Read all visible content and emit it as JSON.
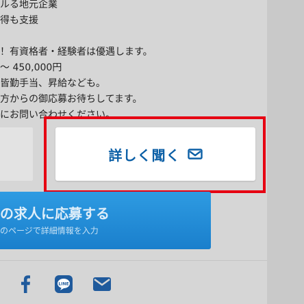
{
  "job_text": {
    "lines": [
      "ルる地元企業",
      "得も支援",
      "",
      "！有資格者・経験者は優遇します。",
      "〜 450,000円",
      "皆勤手当、昇給なども。",
      "方からの御応募お待ちしてます。",
      "にお問い合わせください。"
    ]
  },
  "detail_button": {
    "label": "詳しく聞く",
    "icon": "mail-icon"
  },
  "apply_button": {
    "title": "の求人に応募する",
    "subtitle": "のページで詳細情報を入力"
  },
  "share": {
    "icons": [
      "facebook-icon",
      "line-icon",
      "mail-icon"
    ]
  },
  "colors": {
    "highlight": "#e60012",
    "detail_text": "#0b5fa6",
    "apply_bg": "#1a7fcc",
    "share_icon": "#1f5a9c"
  }
}
